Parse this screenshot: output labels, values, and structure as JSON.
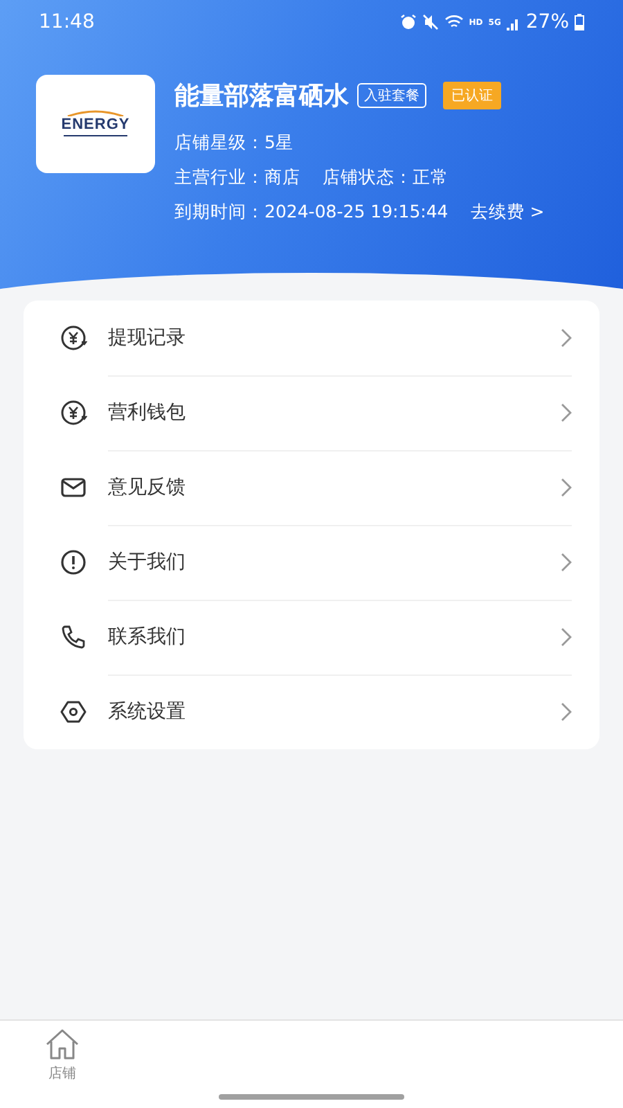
{
  "status_bar": {
    "time": "11:48",
    "network_badge": "HD",
    "network_type": "5G",
    "battery": "27%"
  },
  "shop": {
    "logo_text": "ENERGY",
    "name": "能量部落富硒水",
    "package_button": "入驻套餐",
    "verified_badge": "已认证",
    "star_level": "店铺星级：5星",
    "industry": "主营行业：商店",
    "status": "店铺状态：正常",
    "expiry": "到期时间：2024-08-25 19:15:44",
    "renew_link": "去续费 >"
  },
  "menu": [
    {
      "kind": "yen",
      "label": "提现记录"
    },
    {
      "kind": "yen",
      "label": "营利钱包"
    },
    {
      "kind": "mail",
      "label": "意见反馈"
    },
    {
      "kind": "info",
      "label": "关于我们"
    },
    {
      "kind": "phone",
      "label": "联系我们"
    },
    {
      "kind": "settings",
      "label": "系统设置"
    }
  ],
  "tab_bar": [
    {
      "kind": "home",
      "label": "店铺",
      "selected": false
    }
  ]
}
